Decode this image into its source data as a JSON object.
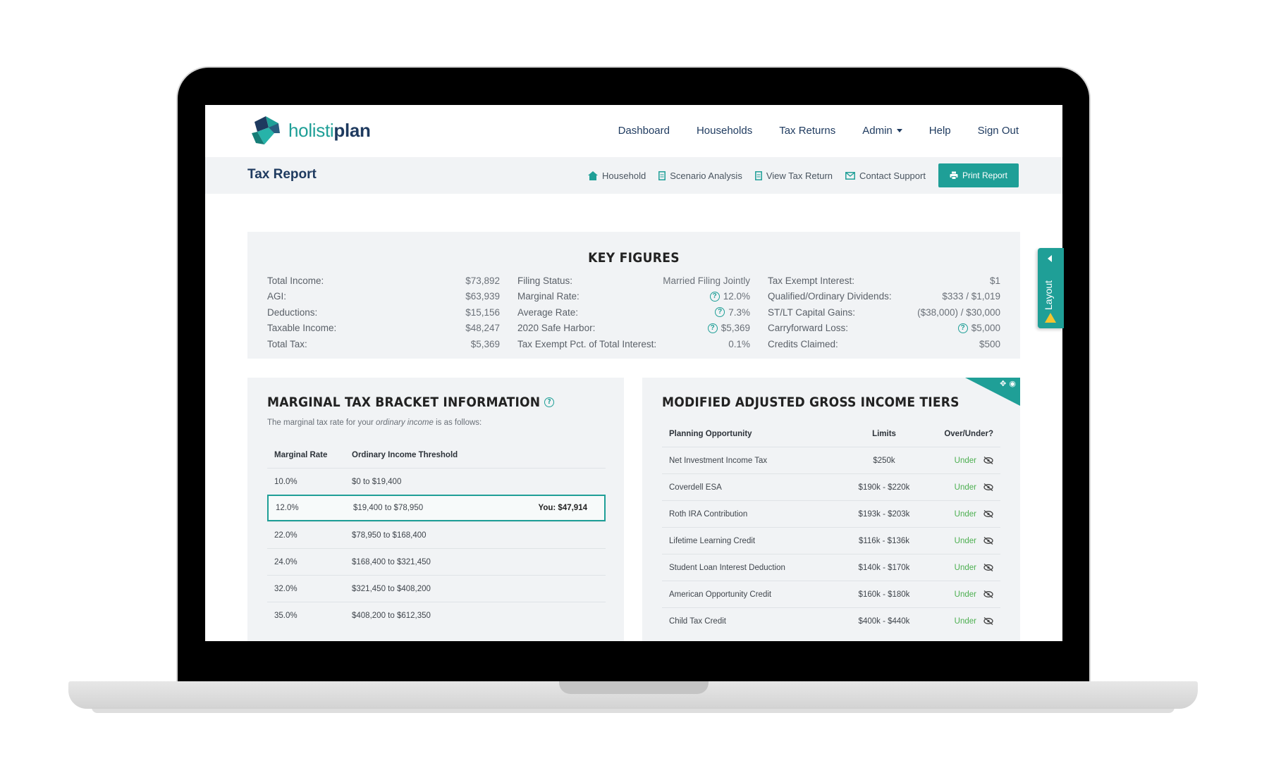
{
  "brand": {
    "name_part1": "holisti",
    "name_part2": "plan",
    "teal": "#1f9f97",
    "navy": "#1e3a5f"
  },
  "nav": {
    "dashboard": "Dashboard",
    "households": "Households",
    "tax_returns": "Tax Returns",
    "admin": "Admin",
    "help": "Help",
    "sign_out": "Sign Out"
  },
  "subbar": {
    "title": "Tax Report",
    "household": "Household",
    "scenario": "Scenario Analysis",
    "view_return": "View Tax Return",
    "contact": "Contact Support",
    "print": "Print Report"
  },
  "key_figures": {
    "title": "KEY FIGURES",
    "col1": [
      {
        "label": "Total Income:",
        "value": "$73,892"
      },
      {
        "label": "AGI:",
        "value": "$63,939"
      },
      {
        "label": "Deductions:",
        "value": "$15,156"
      },
      {
        "label": "Taxable Income:",
        "value": "$48,247"
      },
      {
        "label": "Total Tax:",
        "value": "$5,369"
      }
    ],
    "col2": [
      {
        "label": "Filing Status:",
        "value": "Married Filing Jointly"
      },
      {
        "label": "Marginal Rate:",
        "value": "12.0%"
      },
      {
        "label": "Average Rate:",
        "value": "7.3%"
      },
      {
        "label": "2020 Safe Harbor:",
        "value": "$5,369"
      },
      {
        "label": "Tax Exempt Pct. of Total Interest:",
        "value": "0.1%"
      }
    ],
    "col3": [
      {
        "label": "Tax Exempt Interest:",
        "value": "$1"
      },
      {
        "label": "Qualified/Ordinary Dividends:",
        "value": "$333 / $1,019"
      },
      {
        "label": "ST/LT Capital Gains:",
        "value": "($38,000) / $30,000"
      },
      {
        "label": "Carryforward Loss:",
        "value": "$5,000"
      },
      {
        "label": "Credits Claimed:",
        "value": "$500"
      }
    ]
  },
  "marginal": {
    "title": "MARGINAL TAX BRACKET INFORMATION",
    "desc_pre": "The marginal tax rate for your ",
    "desc_em": "ordinary income",
    "desc_post": " is as follows:",
    "col_rate": "Marginal Rate",
    "col_threshold": "Ordinary Income Threshold",
    "rows": [
      {
        "rate": "10.0%",
        "threshold": "$0 to $19,400",
        "you": ""
      },
      {
        "rate": "12.0%",
        "threshold": "$19,400 to $78,950",
        "you": "You: $47,914"
      },
      {
        "rate": "22.0%",
        "threshold": "$78,950 to $168,400",
        "you": ""
      },
      {
        "rate": "24.0%",
        "threshold": "$168,400 to $321,450",
        "you": ""
      },
      {
        "rate": "32.0%",
        "threshold": "$321,450 to $408,200",
        "you": ""
      },
      {
        "rate": "35.0%",
        "threshold": "$408,200 to $612,350",
        "you": ""
      }
    ]
  },
  "magi": {
    "title": "MODIFIED ADJUSTED GROSS INCOME TIERS",
    "col_opp": "Planning Opportunity",
    "col_lim": "Limits",
    "col_ou": "Over/Under?",
    "rows": [
      {
        "opp": "Net Investment Income Tax",
        "lim": "$250k",
        "ou": "Under"
      },
      {
        "opp": "Coverdell ESA",
        "lim": "$190k - $220k",
        "ou": "Under"
      },
      {
        "opp": "Roth IRA Contribution",
        "lim": "$193k - $203k",
        "ou": "Under"
      },
      {
        "opp": "Lifetime Learning Credit",
        "lim": "$116k - $136k",
        "ou": "Under"
      },
      {
        "opp": "Student Loan Interest Deduction",
        "lim": "$140k - $170k",
        "ou": "Under"
      },
      {
        "opp": "American Opportunity Credit",
        "lim": "$160k - $180k",
        "ou": "Under"
      },
      {
        "opp": "Child Tax Credit",
        "lim": "$400k - $440k",
        "ou": "Under"
      }
    ]
  },
  "layout_tab": {
    "label": "Layout"
  }
}
